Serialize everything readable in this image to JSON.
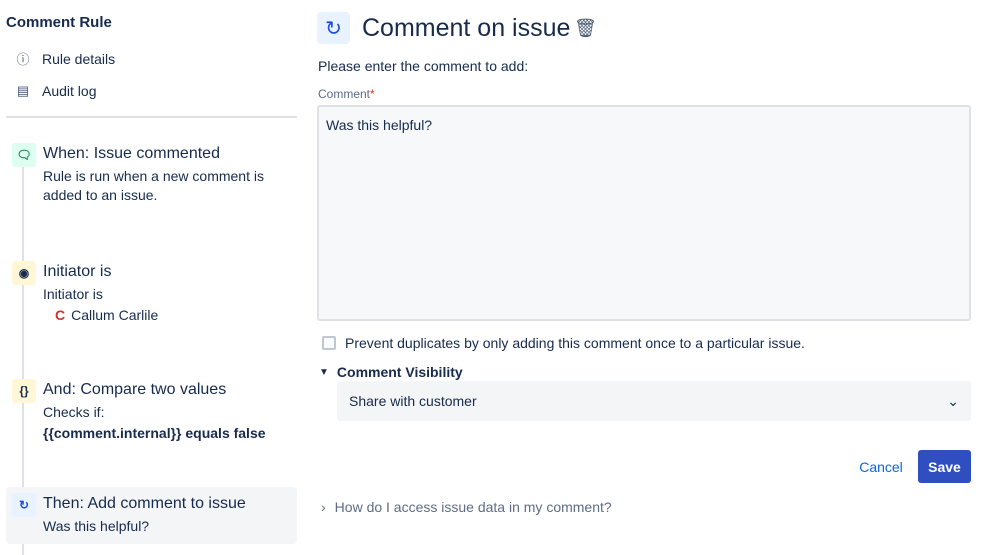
{
  "sidebar": {
    "title": "Comment Rule",
    "nav": [
      {
        "label": "Rule details",
        "icon": "info-icon"
      },
      {
        "label": "Audit log",
        "icon": "document-icon"
      }
    ],
    "steps": [
      {
        "title": "When: Issue commented",
        "desc": "Rule is run when a new comment is added to an issue.",
        "icon": "comment-icon"
      },
      {
        "title": "Initiator is",
        "desc": "Initiator is",
        "user": "Callum Carlile",
        "icon": "user-icon"
      },
      {
        "title": "And: Compare two values",
        "desc": "Checks if:",
        "condition": "{{comment.internal}} equals false",
        "icon": "braces-icon",
        "icon_text": "{}"
      },
      {
        "title": "Then: Add comment to issue",
        "desc": "Was this helpful?",
        "icon": "add-comment-icon"
      }
    ]
  },
  "main": {
    "title": "Comment on issue",
    "instruction": "Please enter the comment to add:",
    "comment_label": "Comment",
    "required_mark": "*",
    "comment_value": "Was this helpful?",
    "prevent_duplicates_label": "Prevent duplicates by only adding this comment once to a particular issue.",
    "prevent_duplicates_checked": false,
    "visibility_label": "Comment Visibility",
    "visibility_value": "Share with customer",
    "cancel": "Cancel",
    "save": "Save",
    "help_link": "How do I access issue data in my comment?"
  },
  "colors": {
    "primary": "#0c66e4",
    "save_bg": "#2f4fc1"
  }
}
